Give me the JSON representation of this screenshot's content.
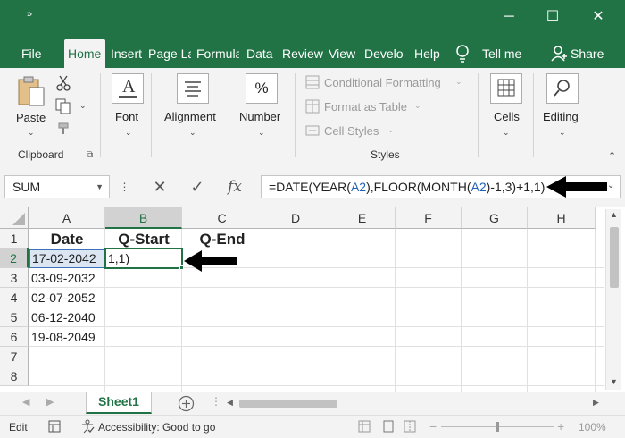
{
  "window": {
    "quick_access": "»",
    "controls": {
      "minimize": "─",
      "maximize": "☐",
      "close": "✕"
    }
  },
  "tabs": [
    {
      "label": "File"
    },
    {
      "label": "Home"
    },
    {
      "label": "Insert"
    },
    {
      "label": "Page La"
    },
    {
      "label": "Formula"
    },
    {
      "label": "Data"
    },
    {
      "label": "Review"
    },
    {
      "label": "View"
    },
    {
      "label": "Develo"
    },
    {
      "label": "Help"
    }
  ],
  "active_tab": "Home",
  "tell_me": "Tell me",
  "share": "Share",
  "ribbon": {
    "clipboard": {
      "paste": "Paste",
      "label": "Clipboard"
    },
    "font": {
      "label": "Font"
    },
    "alignment": {
      "label": "Alignment"
    },
    "number": {
      "label": "Number",
      "symbol": "%"
    },
    "styles": {
      "conditional": "Conditional Formatting",
      "format_table": "Format as Table",
      "cell_styles": "Cell Styles",
      "label": "Styles"
    },
    "cells": {
      "label": "Cells"
    },
    "editing": {
      "label": "Editing"
    }
  },
  "formula_bar": {
    "name_box": "SUM",
    "fx": "fx",
    "formula_parts": [
      "=DATE(YEAR(",
      "A2",
      "),FLOOR(MONTH(",
      "A2",
      ")-1,3)+1,1)"
    ]
  },
  "columns": [
    "A",
    "B",
    "C",
    "D",
    "E",
    "F",
    "G",
    "H"
  ],
  "selected_column": "B",
  "rows": [
    "1",
    "2",
    "3",
    "4",
    "5",
    "6",
    "7",
    "8"
  ],
  "selected_row": "2",
  "cells": {
    "A1": "Date",
    "B1": "Q-Start",
    "C1": "Q-End",
    "A2": "17-02-2042",
    "B2": "1,1)",
    "A3": "03-09-2032",
    "A4": "02-07-2052",
    "A5": "06-12-2040",
    "A6": "19-08-2049"
  },
  "sheet_tab": "Sheet1",
  "status": {
    "mode": "Edit",
    "accessibility": "Accessibility: Good to go",
    "zoom": "100%"
  },
  "colors": {
    "excel_green": "#217346",
    "reference_blue": "#1f5fb5"
  }
}
